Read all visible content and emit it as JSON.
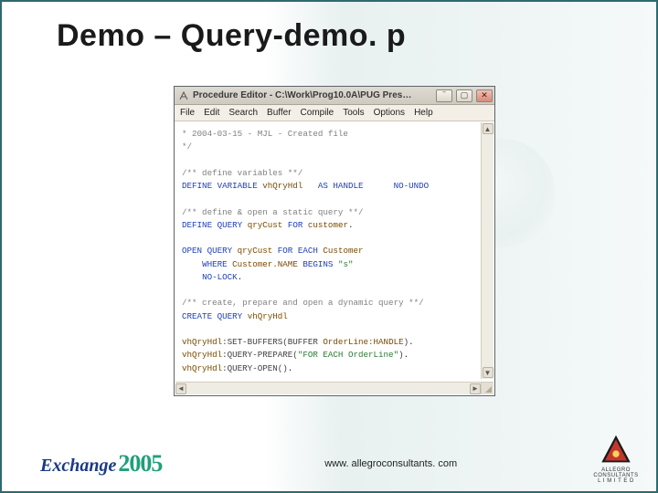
{
  "slide": {
    "title": "Demo – Query-demo. p"
  },
  "window": {
    "title": "Procedure Editor  -  C:\\Work\\Prog10.0A\\PUG Pres…",
    "menu": [
      "File",
      "Edit",
      "Search",
      "Buffer",
      "Compile",
      "Tools",
      "Options",
      "Help"
    ]
  },
  "code": {
    "l01": "* 2004-03-15 - MJL - Created file",
    "l02": "*/",
    "l03_cmt": "/** define variables **/",
    "l04_kw1": "DEFINE VARIABLE",
    "l04_id": "vhQryHdl",
    "l04_kw2": "AS HANDLE",
    "l04_kw3": "NO-UNDO",
    "l05_cmt": "/** define & open a static query **/",
    "l06_kw": "DEFINE QUERY",
    "l06_id": "qryCust",
    "l06_for": "FOR",
    "l06_tbl": "customer",
    "l07_kw": "OPEN QUERY",
    "l07_id": "qryCust",
    "l07_for": "FOR EACH",
    "l07_tbl": "Customer",
    "l08_kw": "WHERE",
    "l08_fld": "Customer.NAME",
    "l08_op": "BEGINS",
    "l08_str": "\"s\"",
    "l09_kw": "NO-LOCK",
    "l10_cmt": "/** create, prepare and open a dynamic query **/",
    "l11_kw": "CREATE QUERY",
    "l11_id": "vhQryHdl",
    "l12_id": "vhQryHdl",
    "l12_m": ":SET-BUFFERS(BUFFER",
    "l12_arg": "OrderLine:HANDLE",
    "l12_cl": ")",
    "l13_id": "vhQryHdl",
    "l13_m": ":QUERY-PREPARE(",
    "l13_str": "\"FOR EACH OrderLine\"",
    "l13_cl": ")",
    "l14_id": "vhQryHdl",
    "l14_m": ":QUERY-OPEN()"
  },
  "footer": {
    "url": "www. allegroconsultants. com",
    "left_brand_a": "Exchange",
    "left_brand_b": "2005",
    "right_brand_a": "ALLEGRO",
    "right_brand_b": "CONSULTANTS",
    "right_brand_c": "L I M I T E D"
  }
}
